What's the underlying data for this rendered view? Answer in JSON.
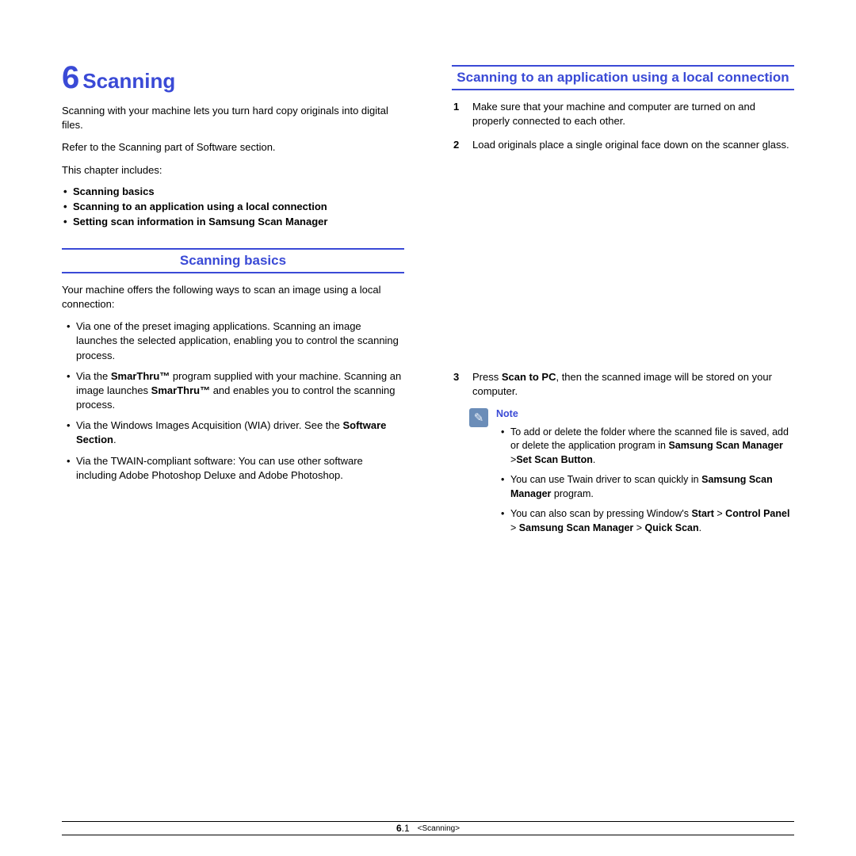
{
  "chapter": {
    "number": "6",
    "title": "Scanning"
  },
  "intro": {
    "p1": "Scanning with your machine lets you turn hard copy originals into digital files.",
    "p2": "Refer to the Scanning part of Software section.",
    "p3": "This chapter includes:"
  },
  "topics": [
    "Scanning basics",
    "Scanning to an application using a local connection",
    "Setting scan information in Samsung Scan Manager"
  ],
  "section1": {
    "heading": "Scanning basics",
    "intro": "Your machine offers the following ways to scan an image using a local connection:",
    "bullets": {
      "b1": "Via one of the preset imaging applications. Scanning an image launches the selected application, enabling you to control the scanning process.",
      "b2a": "Via the ",
      "b2b": "SmarThru™",
      "b2c": " program supplied with your machine. Scanning an image launches ",
      "b2d": "SmarThru™",
      "b2e": " and enables you to control the scanning process.",
      "b3a": "Via the Windows Images Acquisition (WIA) driver. See the ",
      "b3b": "Software Section",
      "b3c": ".",
      "b4": "Via the TWAIN-compliant software: You can use other software including Adobe Photoshop Deluxe and Adobe Photoshop."
    }
  },
  "section2": {
    "heading": "Scanning to an application using a local connection",
    "steps": {
      "s1": "Make sure that your machine and computer are turned on and properly connected to each other.",
      "s2": "Load originals place a single original face down on the scanner glass.",
      "s3a": "Press ",
      "s3b": "Scan to PC",
      "s3c": ", then the scanned image will be stored on your computer."
    },
    "note": {
      "title": "Note",
      "n1a": "To add or delete the folder where the scanned file is saved, add or delete the application program in ",
      "n1b": "Samsung Scan Manager",
      "n1c": " >",
      "n1d": "Set Scan Button",
      "n1e": ".",
      "n2a": "You can use Twain driver to scan quickly in ",
      "n2b": "Samsung Scan Manager",
      "n2c": " program.",
      "n3a": "You can also scan by pressing Window's ",
      "n3b": "Start",
      "n3c": " > ",
      "n3d": "Control Panel",
      "n3e": " > ",
      "n3f": "Samsung Scan Manager",
      "n3g": " > ",
      "n3h": "Quick Scan",
      "n3i": "."
    }
  },
  "footer": {
    "pageMajor": "6",
    "pageMinor": ".1",
    "crumb": "<Scanning>"
  }
}
